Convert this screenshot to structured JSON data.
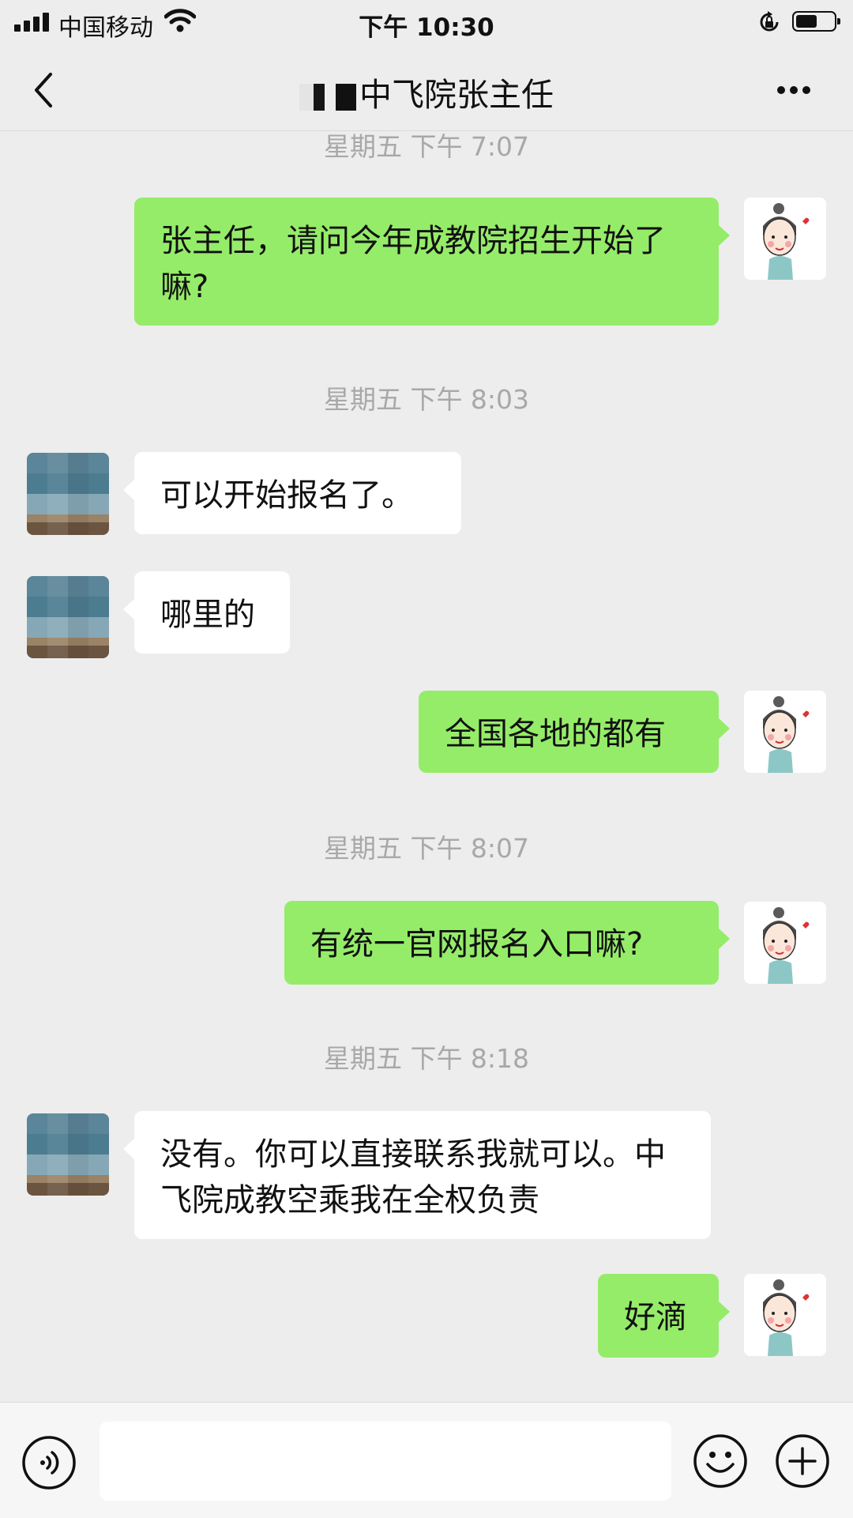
{
  "status_bar": {
    "carrier": "中国移动",
    "time": "下午 10:30",
    "icons": [
      "signal-bars-icon",
      "wifi-icon",
      "orientation-lock-icon",
      "battery-icon"
    ]
  },
  "nav": {
    "back_icon": "chevron-left-icon",
    "title": "中飞院张主任",
    "more_icon": "ellipsis-icon"
  },
  "chat": {
    "timestamps": [
      "星期五 下午 7:07",
      "星期五 下午 8:03",
      "星期五 下午 8:07",
      "星期五 下午 8:18"
    ],
    "messages": [
      {
        "sender": "me",
        "text": "张主任，请问今年成教院招生开始了嘛?"
      },
      {
        "sender": "other",
        "text": "可以开始报名了。"
      },
      {
        "sender": "other",
        "text": "哪里的"
      },
      {
        "sender": "me",
        "text": "全国各地的都有"
      },
      {
        "sender": "me",
        "text": "有统一官网报名入口嘛?"
      },
      {
        "sender": "other",
        "text": "没有。你可以直接联系我就可以。中飞院成教空乘我在全权负责"
      },
      {
        "sender": "me",
        "text": "好滴"
      }
    ]
  },
  "input_bar": {
    "voice_icon": "voice-icon",
    "emoji_icon": "emoji-icon",
    "plus_icon": "plus-circle-icon"
  },
  "colors": {
    "background": "#ededed",
    "my_bubble": "#95ec69",
    "other_bubble": "#ffffff",
    "timestamp_text": "#a8a8a8"
  }
}
